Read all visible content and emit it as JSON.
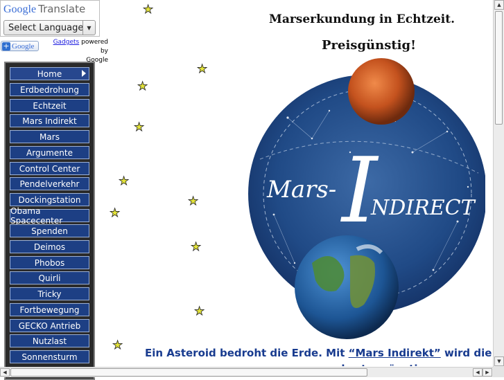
{
  "translate": {
    "logo_google": "Google",
    "logo_word": "Translate",
    "select_label": "Select Language",
    "badge_text": "Google",
    "gadgets_link": "Gadgets",
    "gadgets_suffix": "powered by",
    "gadgets_brand": "Google"
  },
  "menu": {
    "items": [
      {
        "label": "Home"
      },
      {
        "label": "Erdbedrohung"
      },
      {
        "label": "Echtzeit"
      },
      {
        "label": "Mars Indirekt"
      },
      {
        "label": "Mars"
      },
      {
        "label": "Argumente"
      },
      {
        "label": "Control Center"
      },
      {
        "label": "Pendelverkehr"
      },
      {
        "label": "Dockingstation"
      },
      {
        "label": "Obama Spacecenter"
      },
      {
        "label": "Spenden"
      },
      {
        "label": "Deimos"
      },
      {
        "label": "Phobos"
      },
      {
        "label": "Quirli"
      },
      {
        "label": "Tricky"
      },
      {
        "label": "Fortbewegung"
      },
      {
        "label": "GECKO Antrieb"
      },
      {
        "label": "Nutzlast"
      },
      {
        "label": "Sonnensturm"
      }
    ]
  },
  "header": {
    "title": "Marserkundung in Echtzeit.",
    "subtitle": "Preisgünstig!"
  },
  "logo": {
    "text_mars": "Mars-",
    "text_i": "I",
    "text_ndirect": "NDIRECT"
  },
  "body": {
    "asteroid_prefix": "Ein Asteroid bedroht die Erde. Mit ",
    "asteroid_link": "“Mars Indirekt”",
    "asteroid_suffix": " wird die",
    "asteroid_line2": "... kostengünstig ..."
  },
  "colors": {
    "menu_bg": "#1d3f84",
    "link_blue": "#183b8f",
    "star_yellow": "#e4e43a"
  },
  "icons": {
    "star": "star-icon",
    "menu_arrow": "triangle-right-icon",
    "dropdown": "chevron-down-icon"
  }
}
